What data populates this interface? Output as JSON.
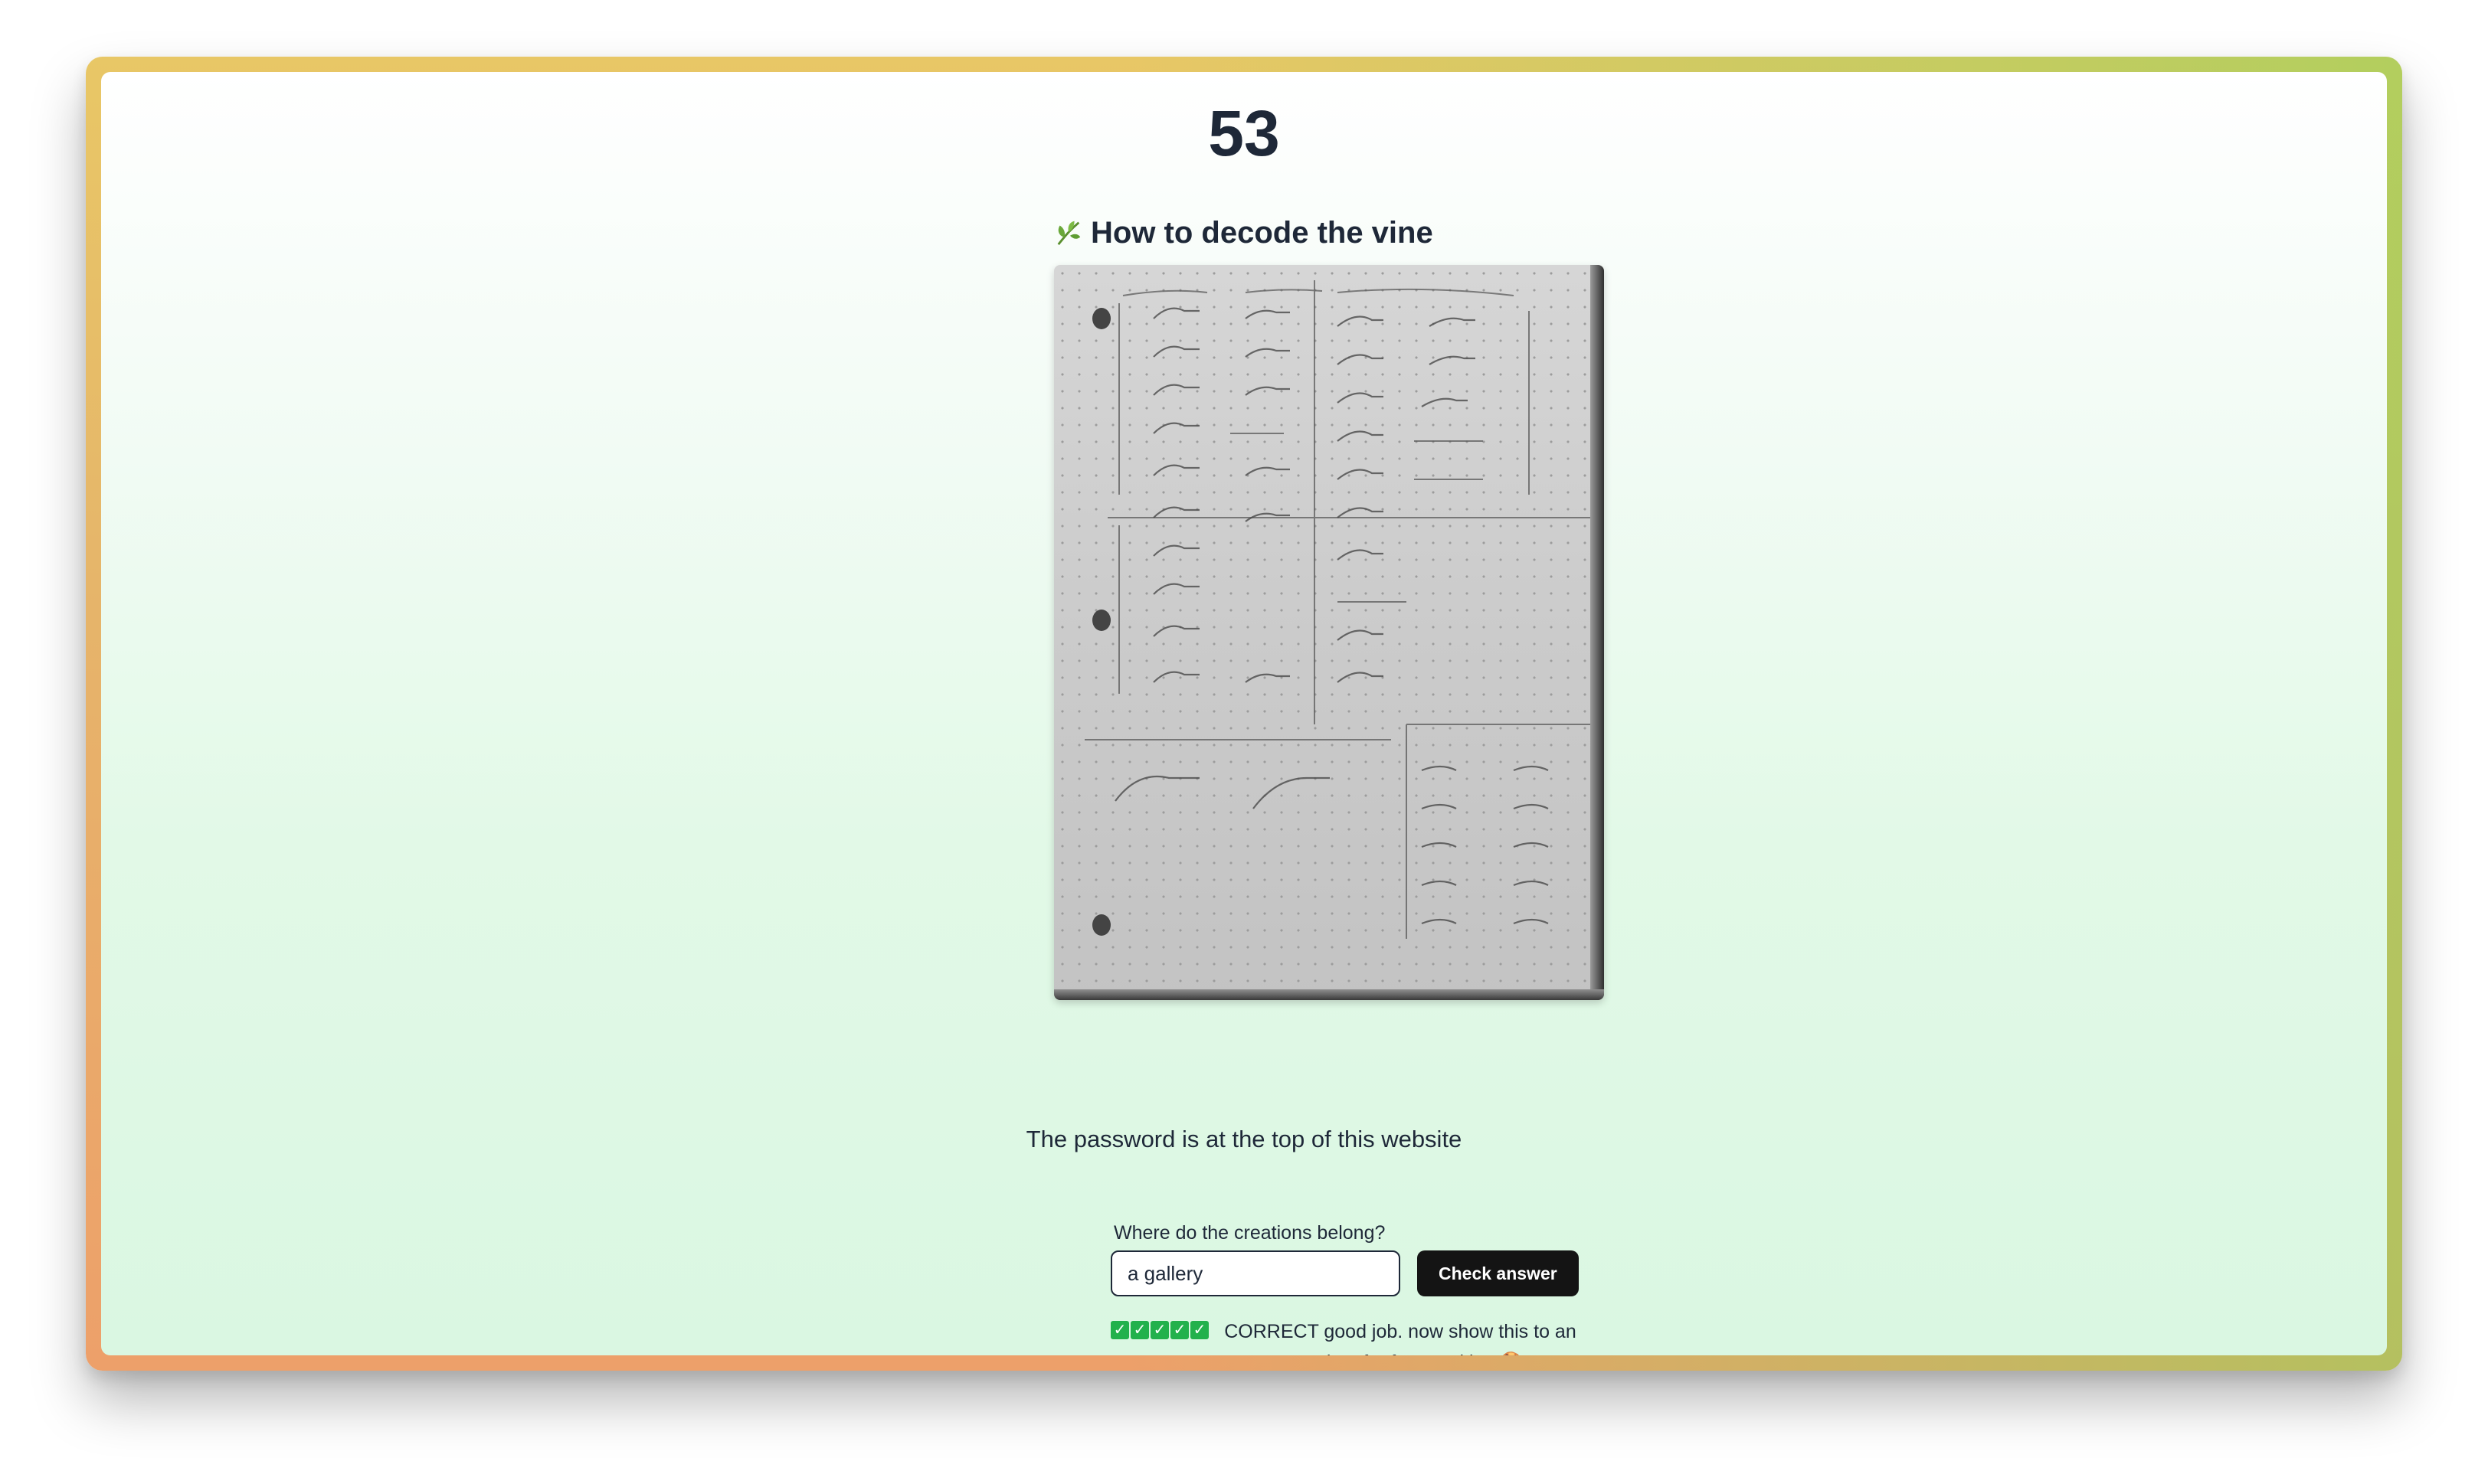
{
  "page": {
    "number": "53"
  },
  "section": {
    "icon": "leaf-icon",
    "title": "How to decode the vine"
  },
  "hint": "The password is at the top of this website",
  "form": {
    "label": "Where do the creations belong?",
    "input_value": "a gallery",
    "button_label": "Check answer"
  },
  "result": {
    "check_count": 5,
    "check_glyph": "✓",
    "text": "CORRECT good job. now show this to an organizer for free cookies 🍪"
  },
  "colors": {
    "heading": "#1e2838",
    "button": "#141414",
    "check": "#22b14c"
  }
}
